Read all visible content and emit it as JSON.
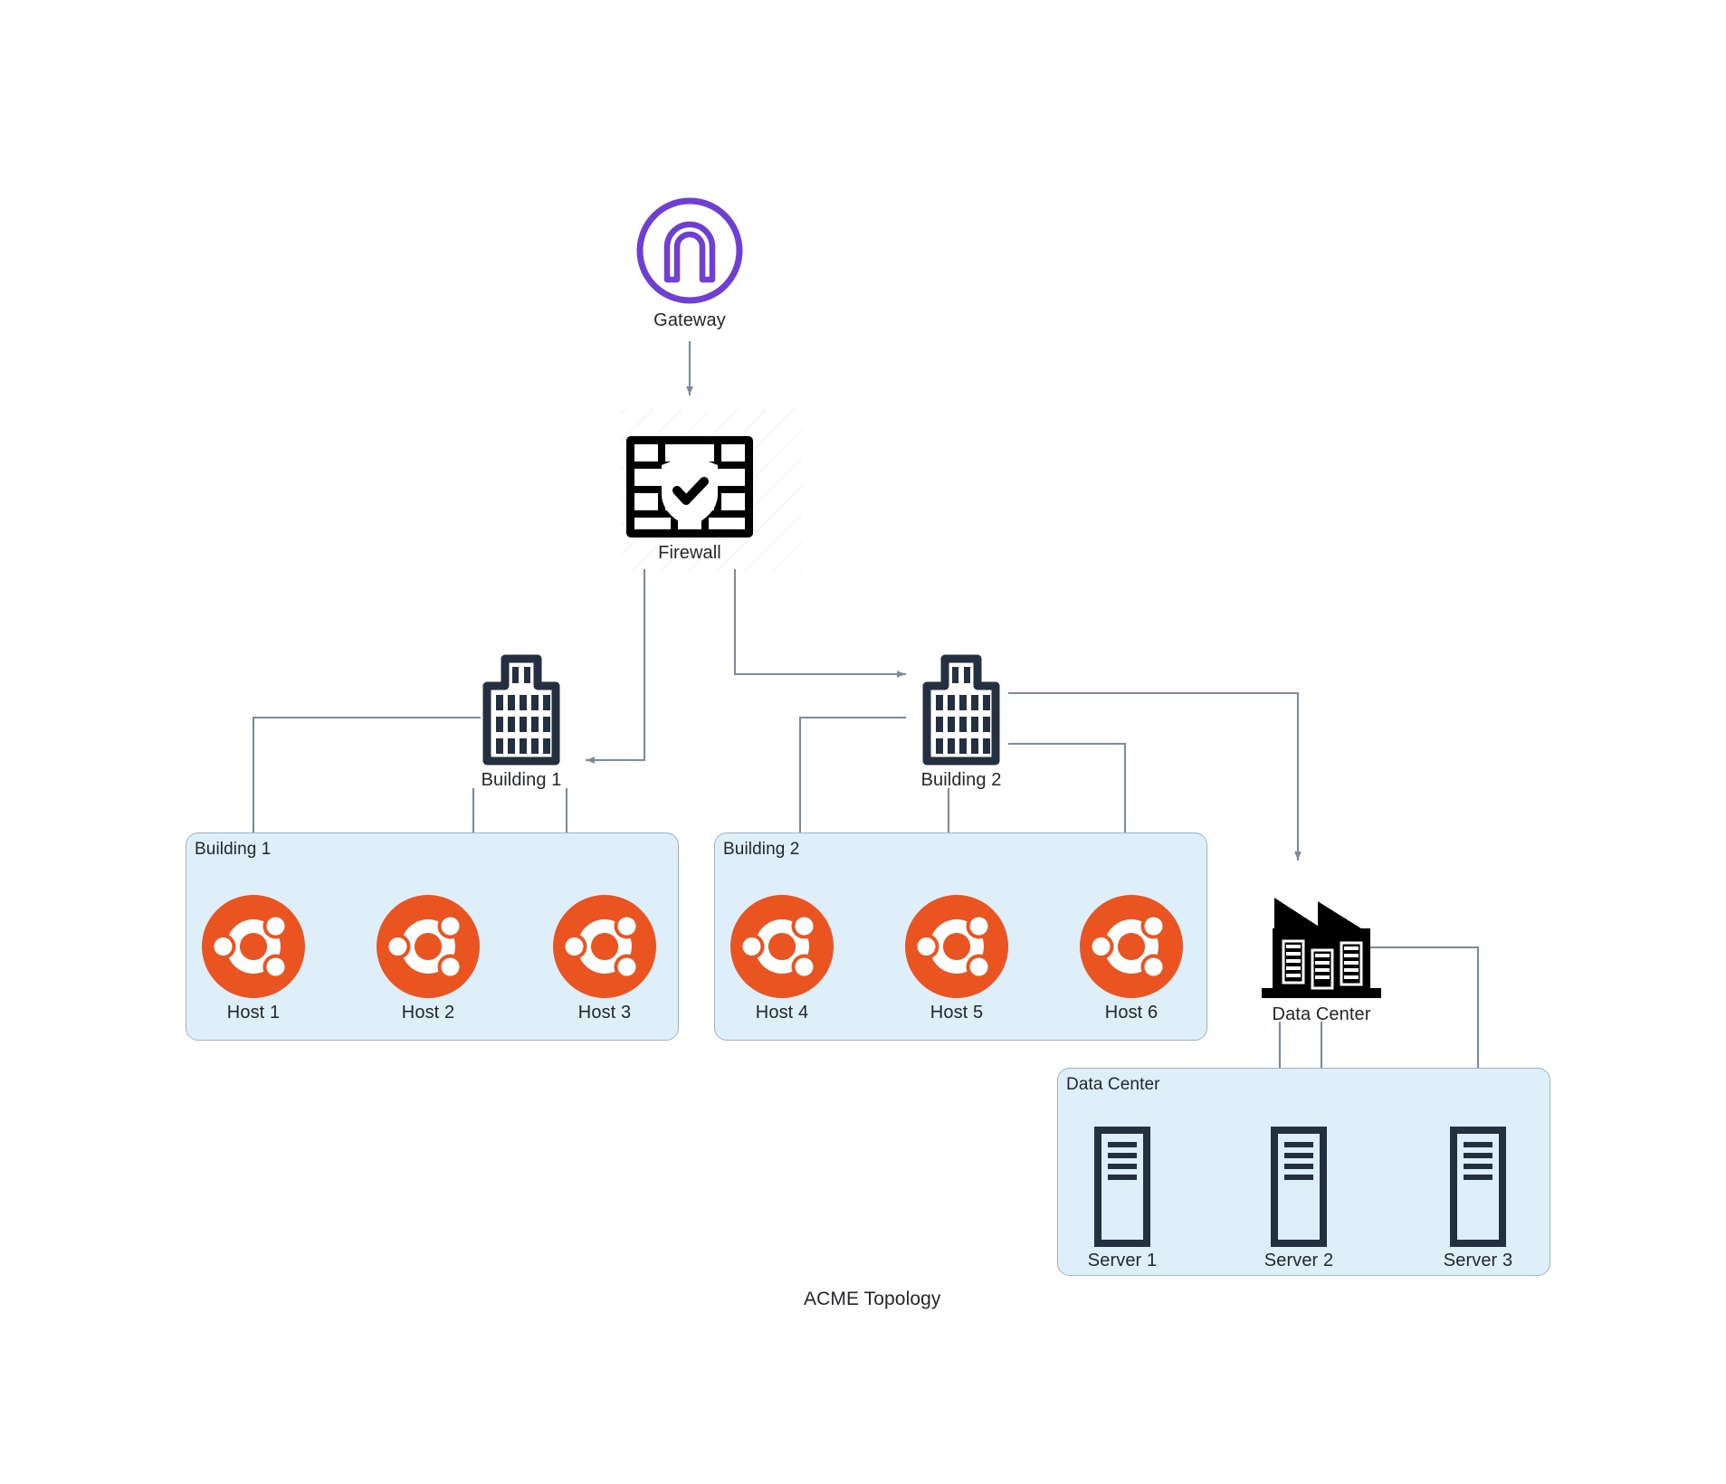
{
  "diagram": {
    "title": "ACME Topology",
    "colors": {
      "gateway_purple": "#6f3fd4",
      "ubuntu_orange": "#E95420",
      "group_fill": "#deeffa",
      "group_border": "#9bb3c4",
      "icon_dark": "#242f40",
      "edge_stroke": "#7a8b99",
      "text": "#23262b",
      "black": "#000000"
    }
  },
  "nodes": {
    "gateway": {
      "label": "Gateway",
      "icon": "gateway-arch-icon"
    },
    "firewall": {
      "label": "Firewall",
      "icon": "firewall-brick-shield-icon"
    },
    "building1": {
      "label": "Building 1",
      "icon": "office-building-icon"
    },
    "building2": {
      "label": "Building 2",
      "icon": "office-building-icon"
    },
    "datacenter": {
      "label": "Data Center",
      "icon": "factory-datacenter-icon"
    }
  },
  "groups": [
    {
      "id": "group-building-1",
      "label": "Building 1"
    },
    {
      "id": "group-building-2",
      "label": "Building 2"
    },
    {
      "id": "group-data-center",
      "label": "Data Center"
    }
  ],
  "hosts_building_1": [
    {
      "label": "Host 1",
      "icon": "ubuntu-logo-icon"
    },
    {
      "label": "Host 2",
      "icon": "ubuntu-logo-icon"
    },
    {
      "label": "Host 3",
      "icon": "ubuntu-logo-icon"
    }
  ],
  "hosts_building_2": [
    {
      "label": "Host 4",
      "icon": "ubuntu-logo-icon"
    },
    {
      "label": "Host 5",
      "icon": "ubuntu-logo-icon"
    },
    {
      "label": "Host 6",
      "icon": "ubuntu-logo-icon"
    }
  ],
  "servers": [
    {
      "label": "Server 1",
      "icon": "server-tower-icon"
    },
    {
      "label": "Server 2",
      "icon": "server-tower-icon"
    },
    {
      "label": "Server 3",
      "icon": "server-tower-icon"
    }
  ],
  "edges": [
    {
      "from": "Gateway",
      "to": "Firewall"
    },
    {
      "from": "Firewall",
      "to": "Building 1"
    },
    {
      "from": "Firewall",
      "to": "Building 2"
    },
    {
      "from": "Building 1",
      "to": "Host 1"
    },
    {
      "from": "Building 1",
      "to": "Host 2"
    },
    {
      "from": "Building 1",
      "to": "Host 3"
    },
    {
      "from": "Building 2",
      "to": "Host 4"
    },
    {
      "from": "Building 2",
      "to": "Host 5"
    },
    {
      "from": "Building 2",
      "to": "Host 6"
    },
    {
      "from": "Building 2",
      "to": "Data Center"
    },
    {
      "from": "Data Center",
      "to": "Server 1"
    },
    {
      "from": "Data Center",
      "to": "Server 2"
    },
    {
      "from": "Data Center",
      "to": "Server 3"
    }
  ]
}
